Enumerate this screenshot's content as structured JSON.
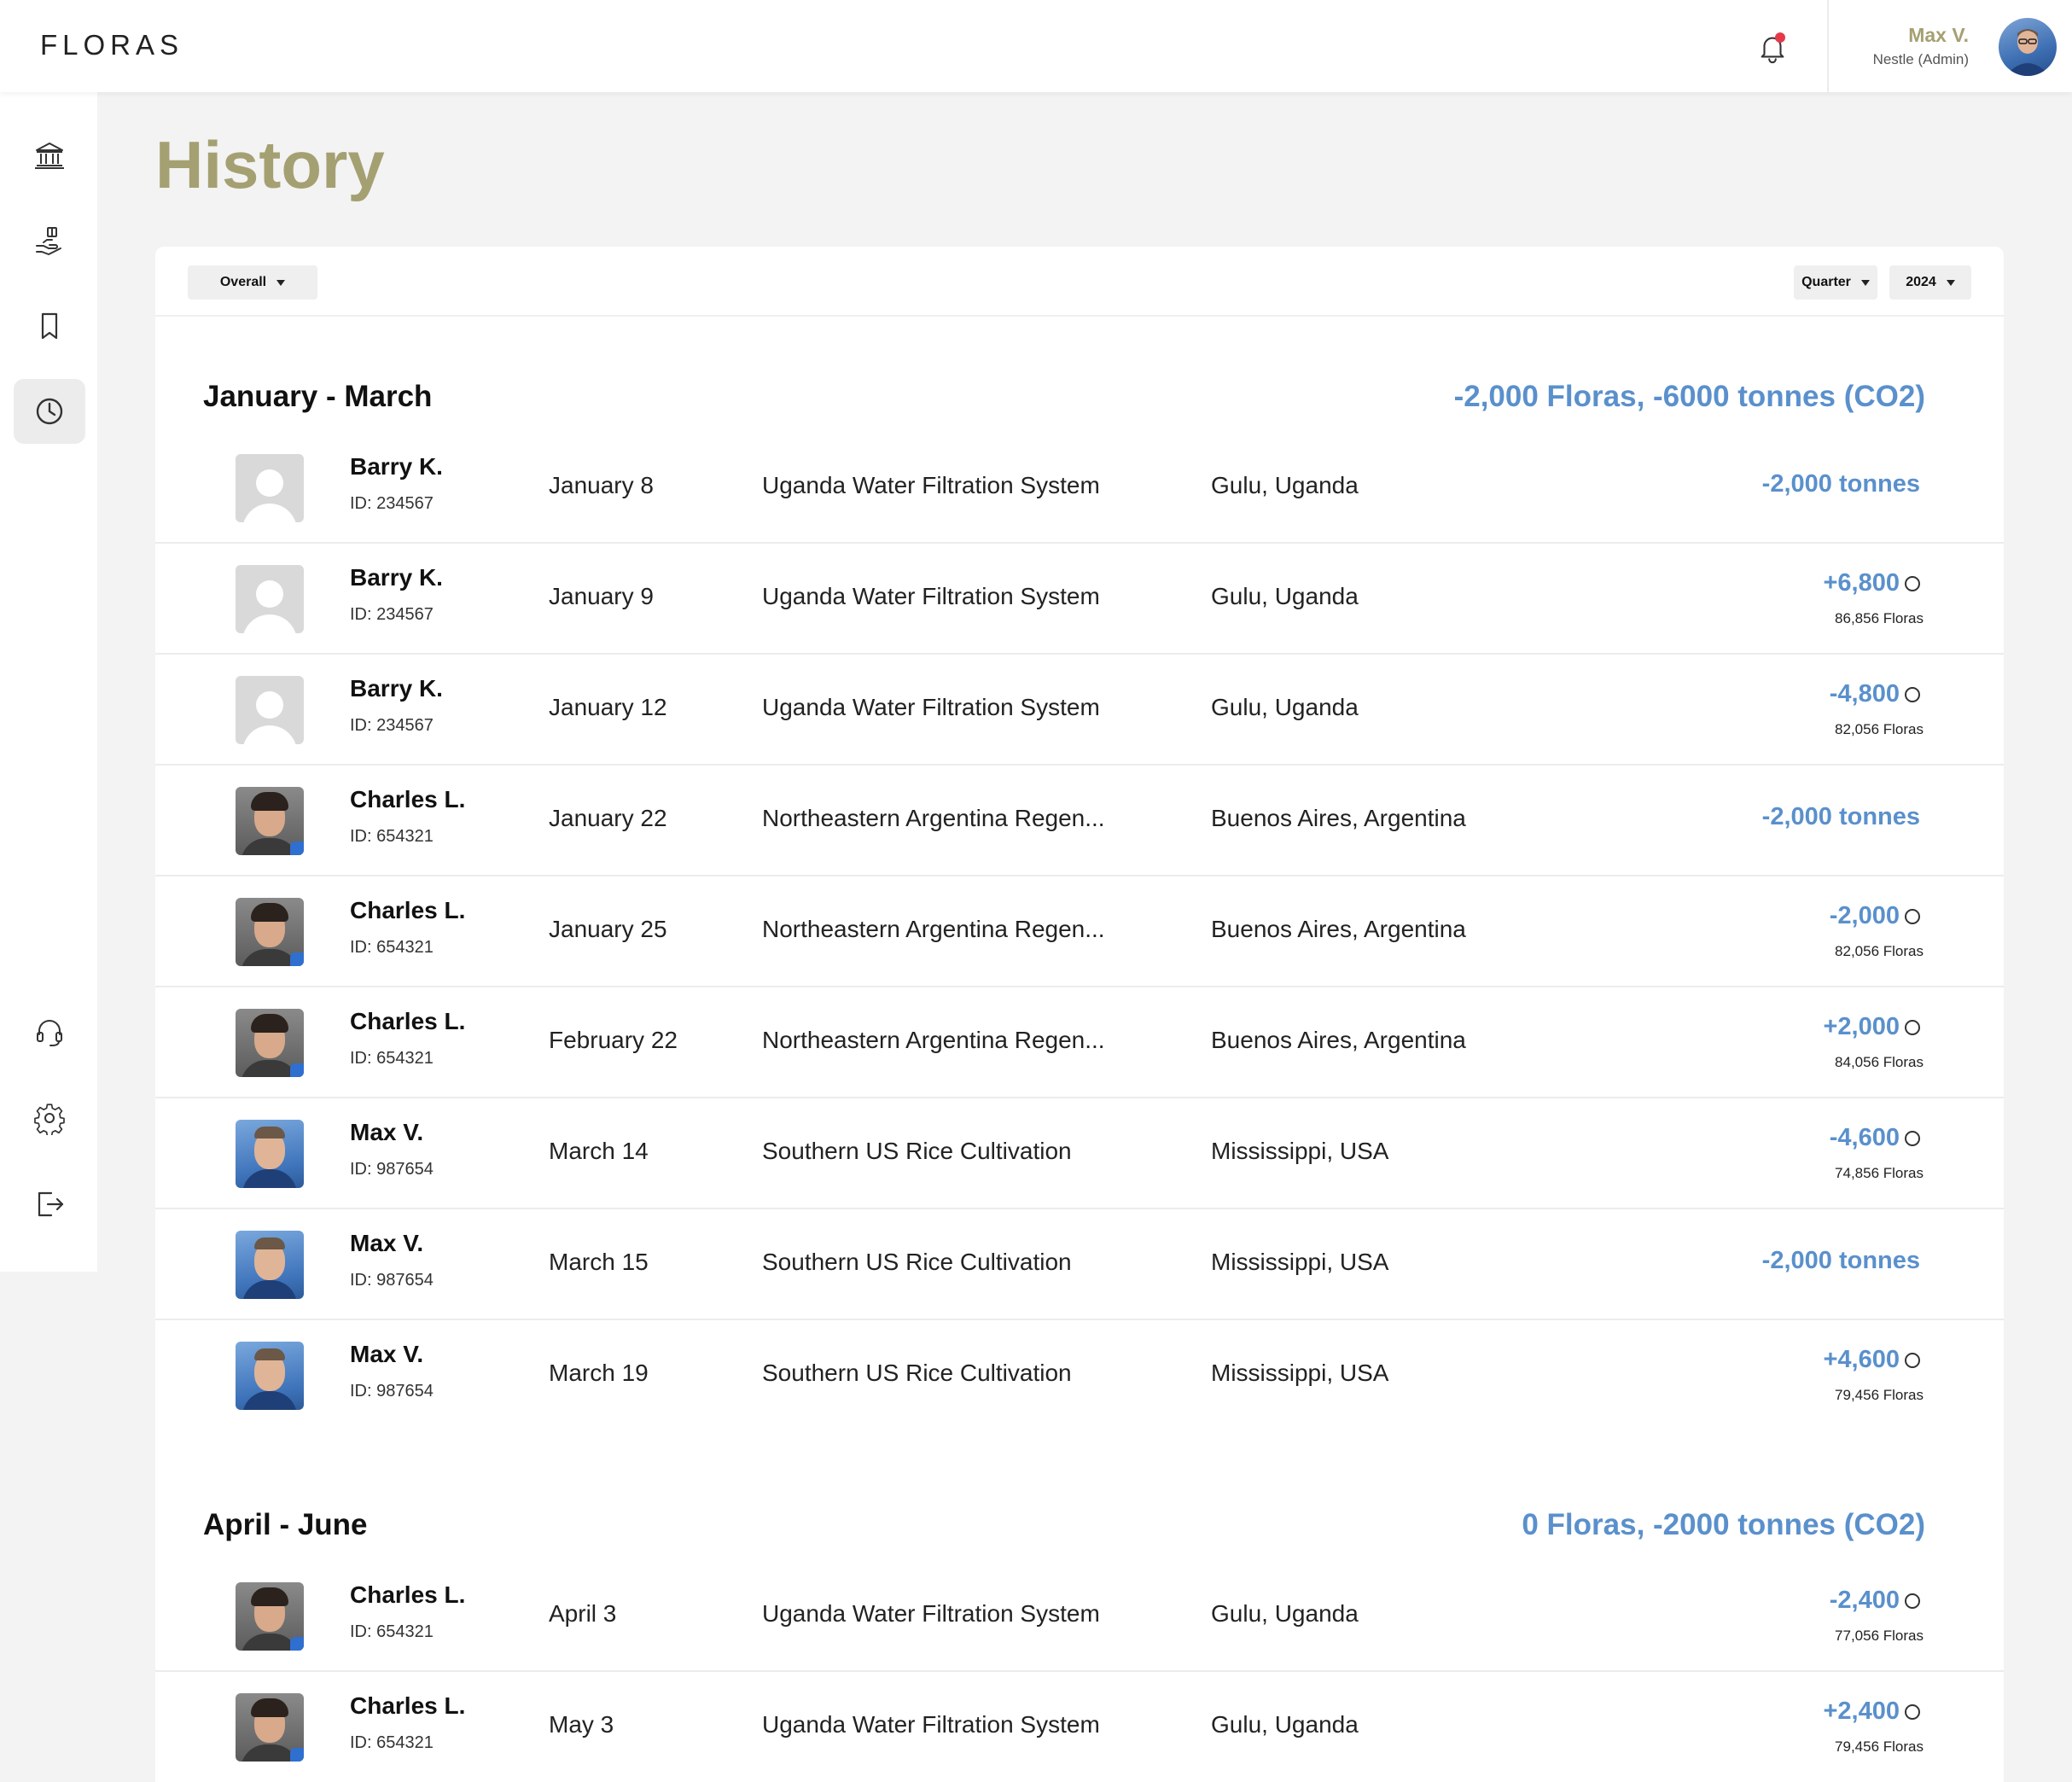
{
  "header": {
    "logo": "FLORAS",
    "user_name": "Max V.",
    "user_role": "Nestle (Admin)"
  },
  "sidebar": {
    "items": [
      {
        "icon": "bank-icon",
        "active": false
      },
      {
        "icon": "hand-coins-icon",
        "active": false
      },
      {
        "icon": "bookmark-icon",
        "active": false
      },
      {
        "icon": "clock-history-icon",
        "active": true
      }
    ],
    "bottom_items": [
      {
        "icon": "headset-icon"
      },
      {
        "icon": "gear-icon"
      },
      {
        "icon": "logout-icon"
      }
    ]
  },
  "page": {
    "title": "History"
  },
  "filters": {
    "scope": "Overall",
    "period": "Quarter",
    "year": "2024"
  },
  "colors": {
    "accent_olive": "#a5a072",
    "amount_blue": "#5a90cc"
  },
  "sections": [
    {
      "title": "January - March",
      "summary": "-2,000 Floras, -6000 tonnes (CO2)",
      "rows": [
        {
          "avatar": "placeholder",
          "name": "Barry K.",
          "id": "ID: 234567",
          "date": "January 8",
          "project": "Uganda Water Filtration System",
          "location": "Gulu, Uganda",
          "amount": "-2,000 tonnes",
          "floras": ""
        },
        {
          "avatar": "placeholder",
          "name": "Barry K.",
          "id": "ID: 234567",
          "date": "January 9",
          "project": "Uganda Water Filtration System",
          "location": "Gulu, Uganda",
          "amount": "+6,800",
          "floras": "86,856 Floras"
        },
        {
          "avatar": "placeholder",
          "name": "Barry K.",
          "id": "ID: 234567",
          "date": "January 12",
          "project": "Uganda Water Filtration System",
          "location": "Gulu, Uganda",
          "amount": "-4,800",
          "floras": "82,056 Floras"
        },
        {
          "avatar": "charles",
          "name": "Charles L.",
          "id": "ID: 654321",
          "date": "January 22",
          "project": "Northeastern Argentina Regen...",
          "location": "Buenos Aires, Argentina",
          "amount": "-2,000 tonnes",
          "floras": ""
        },
        {
          "avatar": "charles",
          "name": "Charles L.",
          "id": "ID: 654321",
          "date": "January 25",
          "project": "Northeastern Argentina Regen...",
          "location": "Buenos Aires, Argentina",
          "amount": "-2,000",
          "floras": "82,056 Floras"
        },
        {
          "avatar": "charles",
          "name": "Charles L.",
          "id": "ID: 654321",
          "date": "February 22",
          "project": "Northeastern Argentina Regen...",
          "location": "Buenos Aires, Argentina",
          "amount": "+2,000",
          "floras": "84,056 Floras"
        },
        {
          "avatar": "max",
          "name": "Max V.",
          "id": "ID: 987654",
          "date": "March 14",
          "project": "Southern US Rice Cultivation",
          "location": "Mississippi, USA",
          "amount": "-4,600",
          "floras": "74,856 Floras"
        },
        {
          "avatar": "max",
          "name": "Max V.",
          "id": "ID: 987654",
          "date": "March 15",
          "project": "Southern US Rice Cultivation",
          "location": "Mississippi, USA",
          "amount": "-2,000 tonnes",
          "floras": ""
        },
        {
          "avatar": "max",
          "name": "Max V.",
          "id": "ID: 987654",
          "date": "March 19",
          "project": "Southern US Rice Cultivation",
          "location": "Mississippi, USA",
          "amount": "+4,600",
          "floras": "79,456 Floras"
        }
      ]
    },
    {
      "title": "April - June",
      "summary": "0 Floras, -2000 tonnes (CO2)",
      "rows": [
        {
          "avatar": "charles",
          "name": "Charles L.",
          "id": "ID: 654321",
          "date": "April 3",
          "project": "Uganda Water Filtration System",
          "location": "Gulu, Uganda",
          "amount": "-2,400",
          "floras": "77,056 Floras"
        },
        {
          "avatar": "charles",
          "name": "Charles L.",
          "id": "ID: 654321",
          "date": "May 3",
          "project": "Uganda Water Filtration System",
          "location": "Gulu, Uganda",
          "amount": "+2,400",
          "floras": "79,456 Floras"
        }
      ]
    }
  ]
}
